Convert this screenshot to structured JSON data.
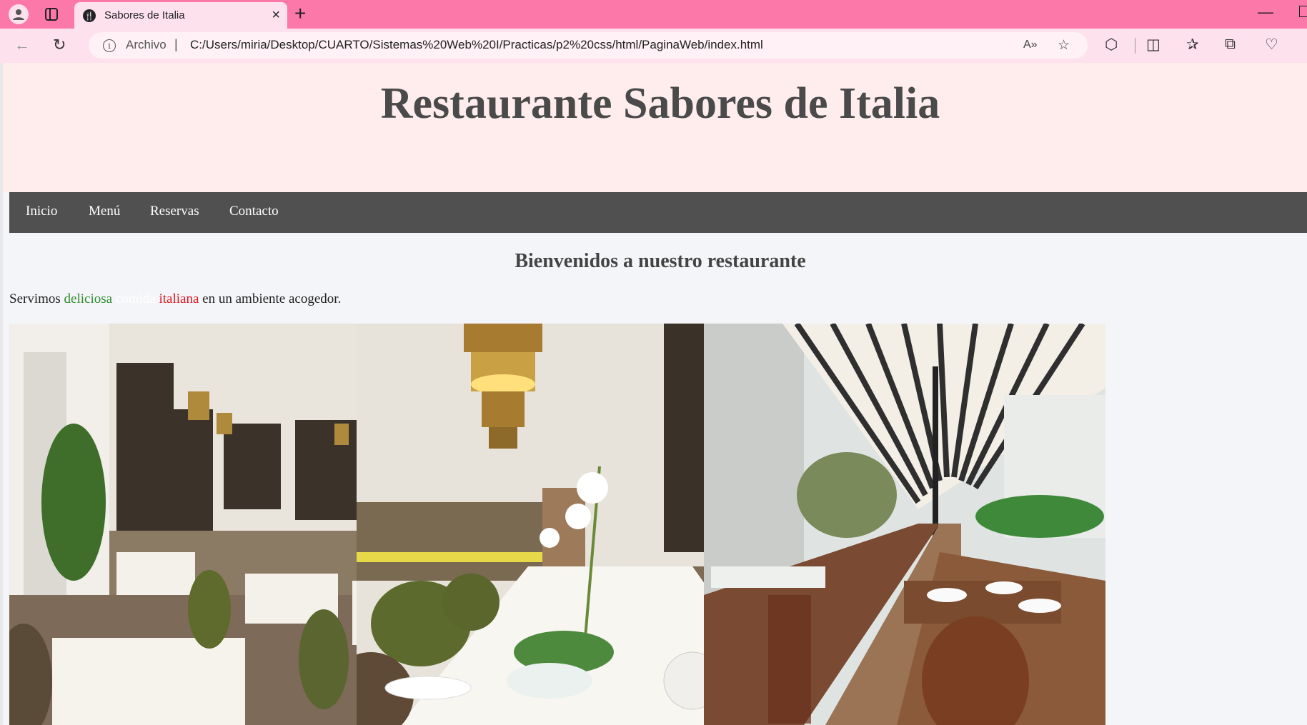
{
  "browser": {
    "tab_title": "Sabores de Italia",
    "new_tab": "+",
    "address_scheme": "Archivo",
    "address_url": "C:/Users/miria/Desktop/CUARTO/Sistemas%20Web%20I/Practicas/p2%20css/html/PaginaWeb/index.html",
    "accent_color": "#fb78a8"
  },
  "site": {
    "title": "Restaurante Sabores de Italia",
    "nav": [
      "Inicio",
      "Menú",
      "Reservas",
      "Contacto"
    ],
    "welcome_heading": "Bienvenidos a nuestro restaurante",
    "intro": {
      "prefix": "Servimos ",
      "word_green": "deliciosa",
      "word_white": "comida",
      "word_red": "italiana",
      "suffix": " en un ambiente acogedor."
    },
    "photos": [
      "restaurant-interior-photo",
      "dining-table-orchid-photo",
      "terrace-pergola-photo"
    ]
  }
}
